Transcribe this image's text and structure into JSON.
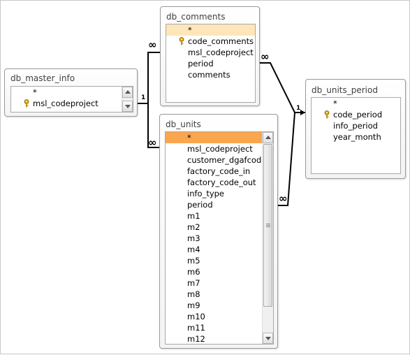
{
  "tables": {
    "master": {
      "name": "db_master_info",
      "fields": [
        "*",
        "msl_codeproject"
      ]
    },
    "comments": {
      "name": "db_comments",
      "fields": [
        "*",
        "code_comments",
        "msl_codeproject",
        "period",
        "comments"
      ]
    },
    "units": {
      "name": "db_units",
      "fields": [
        "*",
        "msl_codeproject",
        "customer_dgafcode",
        "factory_code_in",
        "factory_code_out",
        "info_type",
        "period",
        "m1",
        "m2",
        "m3",
        "m4",
        "m5",
        "m6",
        "m7",
        "m8",
        "m9",
        "m10",
        "m11",
        "m12"
      ]
    },
    "units_period": {
      "name": "db_units_period",
      "fields": [
        "*",
        "code_period",
        "info_period",
        "year_month"
      ]
    }
  },
  "relationships": {
    "one_symbol": "1",
    "many_symbol": "∞"
  },
  "icons": {
    "primary_key": "key-icon",
    "scroll_up": "scroll-up-icon",
    "scroll_down": "scroll-down-icon"
  },
  "colors": {
    "selected_row": "#f9a64f",
    "highlight_row": "#fde6b9"
  }
}
